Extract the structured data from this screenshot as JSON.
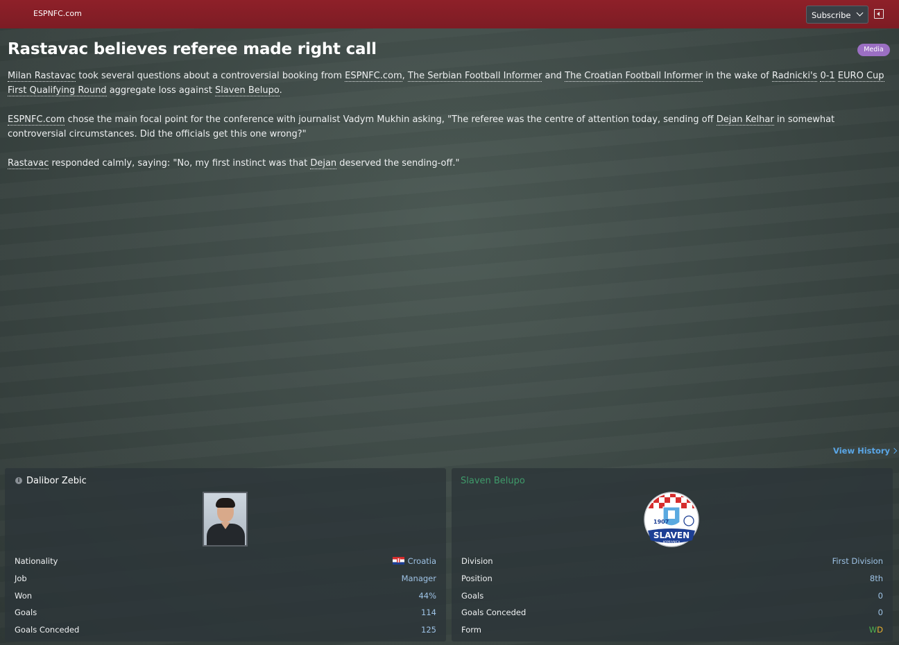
{
  "header": {
    "source": "ESPNFC.com",
    "subscribe_label": "Subscribe"
  },
  "article": {
    "headline": "Rastavac believes referee made right call",
    "badge": "Media",
    "p1": {
      "l1": "Milan Rastavac",
      "t1": " took several questions about a controversial booking from ",
      "l2": "ESPNFC.com",
      "t2": ", ",
      "l3": "The Serbian Football Informer",
      "t3": " and ",
      "l4": "The Croatian Football Informer",
      "t4": " in the wake of ",
      "l5": "Radnicki's",
      "t5": " ",
      "l6": "0-1",
      "t6": " ",
      "l7": "EURO Cup First Qualifying Round",
      "t7": " aggregate loss against ",
      "l8": "Slaven Belupo",
      "t8": "."
    },
    "p2": {
      "l1": "ESPNFC.com",
      "t1": " chose the main focal point for the conference with journalist Vadym Mukhin asking, \"The referee was the centre of attention today, sending off ",
      "l2": "Dejan Kelhar",
      "t2": " in somewhat controversial circumstances. Did the officials get this one wrong?\""
    },
    "p3": {
      "l1": "Rastavac",
      "t1": " responded calmly, saying: \"No, my first instinct was that ",
      "l2": "Dejan",
      "t2": " deserved the sending-off.\""
    }
  },
  "view_history_label": "View History",
  "person_panel": {
    "name": "Dalibor Zebic",
    "info_icon": "i",
    "rows": [
      {
        "label": "Nationality",
        "value": "Croatia"
      },
      {
        "label": "Job",
        "value": "Manager"
      },
      {
        "label": "Won",
        "value": "44%"
      },
      {
        "label": "Goals",
        "value": "114"
      },
      {
        "label": "Goals Conceded",
        "value": "125"
      }
    ]
  },
  "club_panel": {
    "name": "Slaven Belupo",
    "crest_year": "1907",
    "crest_name": "SLAVEN",
    "crest_town": "KOPRIVNICA",
    "rows": [
      {
        "label": "Division",
        "value": "First Division"
      },
      {
        "label": "Position",
        "value": "8th"
      },
      {
        "label": "Goals",
        "value": "0"
      },
      {
        "label": "Goals Conceded",
        "value": "0"
      },
      {
        "label": "Form",
        "value": ""
      }
    ],
    "form": [
      "W",
      "D"
    ]
  },
  "colors": {
    "topbar": "#8e2029",
    "link_blue": "#5aa6e6",
    "value_blue": "#9ec3e6",
    "club_green": "#3f9a6a",
    "media_purple": "#9b6fc3",
    "form_win": "#4fb04f",
    "form_draw": "#e6b030"
  }
}
